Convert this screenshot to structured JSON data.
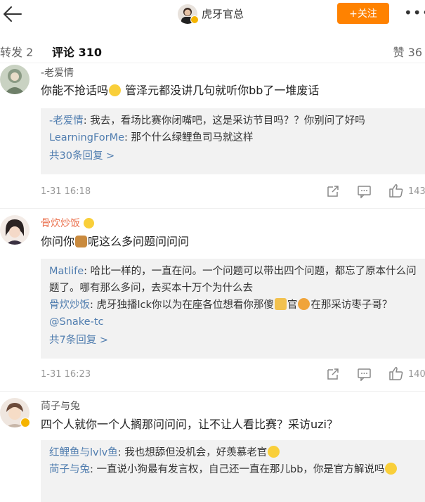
{
  "header": {
    "title": "虎牙官总",
    "follow_label": "+关注",
    "more_label": "•••"
  },
  "tabs": {
    "repost": "转发 2",
    "comments": "评论 310",
    "likes": "赞 36"
  },
  "comments": [
    {
      "user": "-老爱情",
      "text_before": "你能不抢话吗",
      "text_after": "管泽元都没讲几句就听你bb了一堆废话",
      "replies": [
        {
          "name": "-老爱情",
          "text": ": 我去，看场比赛你闭嘴吧，这是采访节目吗？？你别问了好吗"
        },
        {
          "name": "LearningForMe",
          "text": ": 那个什么绿鲤鱼司马就这样"
        }
      ],
      "more": "共30条回复 >",
      "time": "1-31 16:18",
      "likes": "143"
    },
    {
      "user": "骨炊炒饭",
      "text_before": "你问你",
      "text_after": "呢这么多问题问问问",
      "replies": [
        {
          "name": "Matlife",
          "text": ": 哈比一样的，一直在问。一个问题可以带出四个问题，都忘了原本什么问题了。哪有那么多问，去买本十万个为什么去"
        },
        {
          "name": "骨炊炒饭",
          "text": ": 虎牙独播lck你以为在座各位想看你那傻",
          "text2": "官",
          "text3": "在那采访枣子哥？",
          "mention": "@Snake-tc"
        }
      ],
      "more": "共7条回复 >",
      "time": "1-31 16:23",
      "likes": "140"
    },
    {
      "user": "苘子与兔",
      "text": "四个人就你一个人搁那问问问，让不让人看比赛？采访uzi？",
      "replies": [
        {
          "name": "红鲤鱼与lvlv鱼",
          "text": ": 我也想舔但没机会，好羡慕老官"
        },
        {
          "name": "苘子与兔",
          "text": ": 一直说小狗最有发言权，自己还一直在那儿bb，你是官方解说吗"
        }
      ]
    }
  ],
  "colors": {
    "accent": "#ff8200",
    "link": "#507daf",
    "username_orange": "#eb7350"
  }
}
